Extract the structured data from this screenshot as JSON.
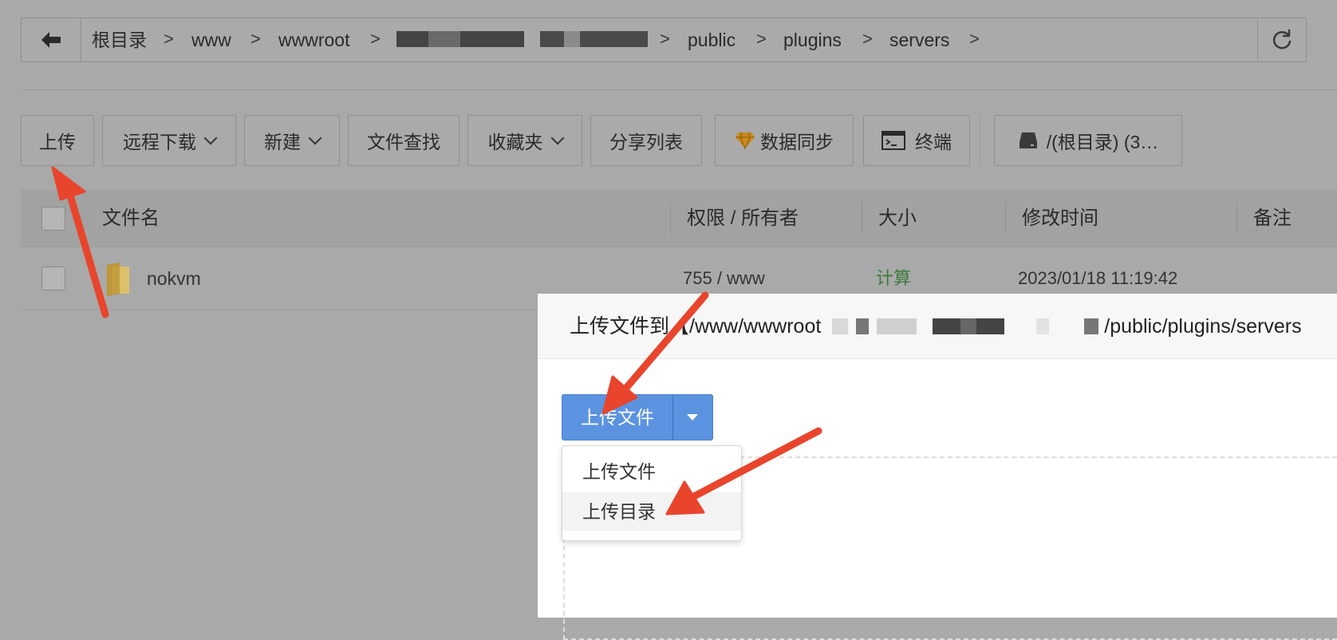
{
  "breadcrumb": {
    "items": [
      "根目录",
      "www",
      "wwwroot",
      "public",
      "plugins",
      "servers"
    ],
    "separator": ">"
  },
  "toolbar": {
    "upload": "上传",
    "remote_download": "远程下载",
    "new": "新建",
    "file_search": "文件查找",
    "favorites": "收藏夹",
    "share_list": "分享列表",
    "data_sync": "数据同步",
    "terminal": "终端",
    "disk": "/(根目录) (3…"
  },
  "table": {
    "headers": {
      "name": "文件名",
      "perm": "权限 / 所有者",
      "size": "大小",
      "mtime": "修改时间",
      "note": "备注"
    },
    "rows": [
      {
        "name": "nokvm",
        "perm": "755 / www",
        "size": "计算",
        "mtime": "2023/01/18 11:19:42"
      }
    ]
  },
  "modal": {
    "title_prefix": "上传文件到【/www/wwwroot",
    "title_suffix": "/public/plugins/servers",
    "upload_button": "上传文件",
    "menu": [
      "上传文件",
      "上传目录"
    ]
  },
  "colors": {
    "primary": "#5b93e0",
    "annotation_arrow": "#e8452c",
    "size_link": "#3c7a3c",
    "folder": "#d8b24a"
  },
  "icons": {
    "back": "arrow-left-icon",
    "refresh": "refresh-icon",
    "data_sync": "diamond-icon",
    "terminal": "terminal-icon",
    "disk": "disk-icon",
    "folder": "folder-icon"
  }
}
